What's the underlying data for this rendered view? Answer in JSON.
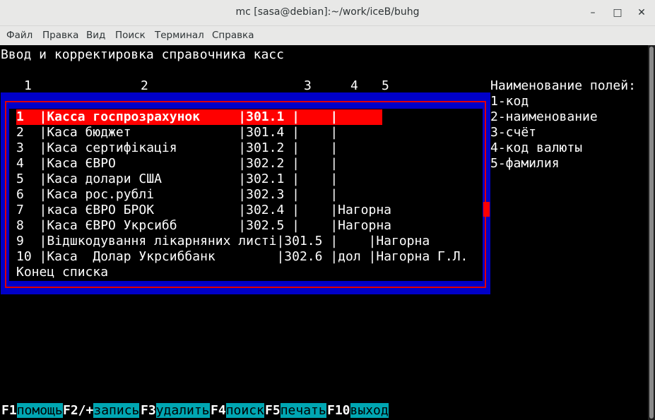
{
  "window": {
    "title": "mc [sasa@debian]:~/work/iceB/buhg",
    "minimize": "–",
    "maximize": "□",
    "close": "✕"
  },
  "menu": [
    "Файл",
    "Правка",
    "Вид",
    "Поиск",
    "Терминал",
    "Справка"
  ],
  "screen": {
    "heading": "Ввод и корректировка справочника касс",
    "column_numbers": [
      "1",
      "2",
      "3",
      "4",
      "5"
    ],
    "legend": {
      "title": "Наименование полей:",
      "items": [
        "1-код",
        "2-наименование",
        "3-счёт",
        "4-код валюты",
        "5-фамилия"
      ]
    }
  },
  "list": {
    "rows": [
      "1  |Касса госпрозрахунок     |301.1 |    |",
      "2  |Каса бюджет              |301.4 |    |",
      "3  |Каса сертифікація        |301.2 |    |",
      "4  |Каса ЄВРО                |302.2 |    |",
      "5  |Каса долари США          |302.1 |    |",
      "6  |Каса рос.рублі           |302.3 |    |",
      "7  |каса ЄВРО БРОК           |302.4 |    |Нагорна",
      "8  |Каса ЄВРО Укрсибб        |302.5 |    |Нагорна",
      "9  |Відшкодування лікарняних листі|301.5 |    |Нагорна",
      "10 |Каса  Долар Укрсиббанк        |302.6 |дол |Нагорна Г.Л."
    ],
    "footer": "Конец списка",
    "selected_index": 0
  },
  "function_keys": [
    {
      "key": "F1",
      "label": "помощь"
    },
    {
      "key": "F2/+",
      "label": "запись"
    },
    {
      "key": "F3",
      "label": "удалить"
    },
    {
      "key": "F4",
      "label": "поиск"
    },
    {
      "key": "F5",
      "label": "печать"
    },
    {
      "key": "F10",
      "label": "выход"
    }
  ],
  "colors": {
    "terminal_bg": "#000000",
    "dialog_blue": "#0000c8",
    "highlight_red": "#ff0000",
    "fkey_label_bg": "#00a6b2"
  }
}
